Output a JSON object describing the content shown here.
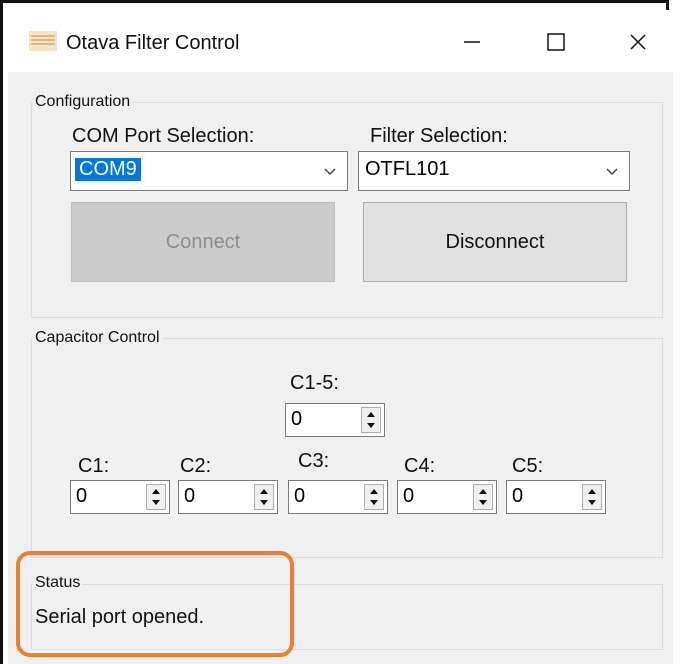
{
  "window": {
    "title": "Otava Filter Control",
    "controls": [
      "minimize-icon",
      "maximize-icon",
      "close-icon"
    ]
  },
  "configuration": {
    "group_label": "Configuration",
    "com_port_label": "COM Port Selection:",
    "com_port_value": "COM9",
    "filter_label": "Filter Selection:",
    "filter_value": "OTFL101",
    "connect_label": "Connect",
    "disconnect_label": "Disconnect"
  },
  "capacitor": {
    "group_label": "Capacitor Control",
    "all": {
      "label": "C1-5:",
      "value": "0"
    },
    "items": [
      {
        "label": "C1:",
        "value": "0"
      },
      {
        "label": "C2:",
        "value": "0"
      },
      {
        "label": "C3:",
        "value": "0"
      },
      {
        "label": "C4:",
        "value": "0"
      },
      {
        "label": "C5:",
        "value": "0"
      }
    ]
  },
  "status": {
    "group_label": "Status",
    "message": "Serial port opened."
  },
  "colors": {
    "highlight": "#ed7d31",
    "selection": "#0078d7"
  }
}
